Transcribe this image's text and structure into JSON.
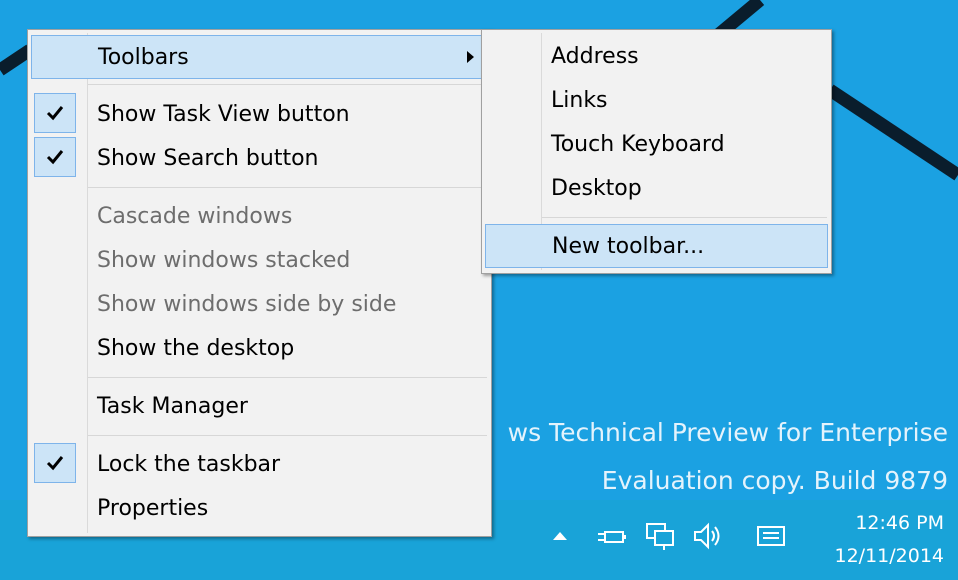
{
  "desktop": {
    "watermark_line1": "ws Technical Preview for Enterprise",
    "watermark_line2": "Evaluation copy. Build 9879",
    "background_color": "#1ba1e2"
  },
  "context_menu": {
    "toolbars": "Toolbars",
    "show_task_view": "Show Task View button",
    "show_search": "Show Search button",
    "cascade": "Cascade windows",
    "stacked": "Show windows stacked",
    "side_by_side": "Show windows side by side",
    "show_desktop": "Show the desktop",
    "task_manager": "Task Manager",
    "lock_taskbar": "Lock the taskbar",
    "properties": "Properties"
  },
  "submenu": {
    "address": "Address",
    "links": "Links",
    "touch_keyboard": "Touch Keyboard",
    "desktop": "Desktop",
    "new_toolbar": "New toolbar..."
  },
  "taskbar": {
    "time": "12:46 PM",
    "date": "12/11/2014",
    "icons": [
      "chevron-up-icon",
      "power-icon",
      "network-icon",
      "volume-icon",
      "action-center-icon"
    ]
  }
}
